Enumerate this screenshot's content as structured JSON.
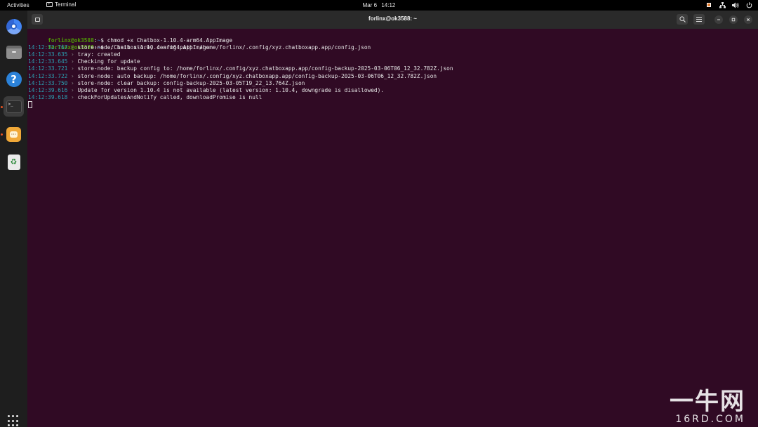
{
  "topbar": {
    "activities": "Activities",
    "app_name": "Terminal",
    "date": "Mar 6",
    "time": "14:12",
    "tray_icons": [
      "screen-record-icon",
      "network-icon",
      "volume-icon",
      "power-icon"
    ]
  },
  "dock": {
    "items": [
      {
        "name": "chromium",
        "icon": "chromium-icon",
        "running": false
      },
      {
        "name": "files",
        "icon": "files-icon",
        "running": false
      },
      {
        "name": "help",
        "icon": "help-icon",
        "running": false
      },
      {
        "name": "terminal",
        "icon": "terminal-icon",
        "running": true
      },
      {
        "name": "chatbox",
        "icon": "chatbox-icon",
        "running": true
      },
      {
        "name": "trash",
        "icon": "trash-icon",
        "running": false
      }
    ],
    "apps_grid_icon": "apps-grid-icon"
  },
  "window": {
    "title": "forlinx@ok3588: ~",
    "buttons": [
      "new-tab-icon",
      "search-icon",
      "menu-icon",
      "minimize-icon",
      "maximize-icon",
      "close-icon"
    ]
  },
  "terminal": {
    "prompts": [
      {
        "user": "forlinx@ok3588",
        "sep": ":",
        "path": "~",
        "symbol": "$ ",
        "command": "chmod +x Chatbox-1.10.4-arm64.AppImage"
      },
      {
        "user": "forlinx@ok3588",
        "sep": ":",
        "path": "~",
        "symbol": "$ ",
        "command": "./Chatbox-1.10.4-arm64.AppImage"
      }
    ],
    "log": [
      {
        "time": "14:12:32.767",
        "arrow": " › ",
        "msg": "store-node: init store, config path: /home/forlinx/.config/xyz.chatboxapp.app/config.json"
      },
      {
        "time": "14:12:33.635",
        "arrow": " › ",
        "msg": "tray: created"
      },
      {
        "time": "14:12:33.645",
        "arrow": " › ",
        "msg": "Checking for update"
      },
      {
        "time": "14:12:33.721",
        "arrow": " › ",
        "msg": "store-node: backup config to: /home/forlinx/.config/xyz.chatboxapp.app/config-backup-2025-03-06T06_12_32.782Z.json"
      },
      {
        "time": "14:12:33.722",
        "arrow": " › ",
        "msg": "store-node: auto backup: /home/forlinx/.config/xyz.chatboxapp.app/config-backup-2025-03-06T06_12_32.782Z.json"
      },
      {
        "time": "14:12:33.750",
        "arrow": " › ",
        "msg": "store-node: clear backup: config-backup-2025-03-05T19_22_13.764Z.json"
      },
      {
        "time": "14:12:39.616",
        "arrow": " › ",
        "msg": "Update for version 1.10.4 is not available (latest version: 1.10.4, downgrade is disallowed)."
      },
      {
        "time": "14:12:39.618",
        "arrow": " › ",
        "msg": "checkForUpdatesAndNotify called, downloadPromise is null"
      }
    ]
  },
  "watermark": {
    "big": "一牛网",
    "small": "16RD.COM"
  },
  "colors": {
    "terminal_bg": "#300a24",
    "prompt_user": "#4e9a06",
    "prompt_path": "#3465a4",
    "timestamp": "#2aa1b3",
    "accent": "#e95420"
  }
}
